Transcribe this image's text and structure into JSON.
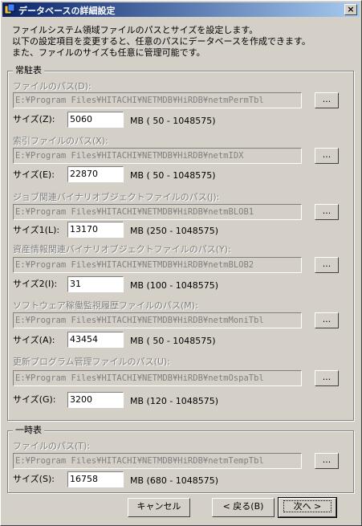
{
  "window": {
    "title": "データベースの詳細設定",
    "close_label": "×"
  },
  "intro": [
    "ファイルシステム領域ファイルのパスとサイズを設定します。",
    "以下の設定項目を変更すると、任意のパスにデータベースを作成できます。",
    "また、ファイルのサイズも任意に管理可能です。"
  ],
  "resident": {
    "legend": "常駐表",
    "items": [
      {
        "path_label": "ファイルのパス(D):",
        "path": "E:¥Program Files¥HITACHI¥NETMDB¥HiRDB¥netmPermTbl",
        "size_label": "サイズ(Z):",
        "size": "5060",
        "range": "MB ( 50 - 1048575)"
      },
      {
        "path_label": "索引ファイルのパス(X):",
        "path": "E:¥Program Files¥HITACHI¥NETMDB¥HiRDB¥netmIDX",
        "size_label": "サイズ(E):",
        "size": "22870",
        "range": "MB ( 50 - 1048575)"
      },
      {
        "path_label": "ジョブ関連バイナリオブジェクトファイルのパス(J):",
        "path": "E:¥Program Files¥HITACHI¥NETMDB¥HiRDB¥netmBLOB1",
        "size_label": "サイズ1(L):",
        "size": "13170",
        "range": "MB (250 - 1048575)"
      },
      {
        "path_label": "資産情報関連バイナリオブジェクトファイルのパス(Y):",
        "path": "E:¥Program Files¥HITACHI¥NETMDB¥HiRDB¥netmBLOB2",
        "size_label": "サイズ2(I):",
        "size": "31",
        "range": "MB (100 - 1048575)"
      },
      {
        "path_label": "ソフトウェア稼働監視履歴ファイルのパス(M):",
        "path": "E:¥Program Files¥HITACHI¥NETMDB¥HiRDB¥netmMoniTbl",
        "size_label": "サイズ(A):",
        "size": "43454",
        "range": "MB ( 50 - 1048575)"
      },
      {
        "path_label": "更新プログラム管理ファイルのパス(U):",
        "path": "E:¥Program Files¥HITACHI¥NETMDB¥HiRDB¥netmOspaTbl",
        "size_label": "サイズ(G):",
        "size": "3200",
        "range": "MB (120 - 1048575)"
      }
    ]
  },
  "temporary": {
    "legend": "一時表",
    "items": [
      {
        "path_label": "ファイルのパス(T):",
        "path": "E:¥Program Files¥HITACHI¥NETMDB¥HiRDB¥netmTempTbl",
        "size_label": "サイズ(S):",
        "size": "16758",
        "range": "MB (680 - 1048575)"
      }
    ]
  },
  "browse_label": "...",
  "buttons": {
    "cancel": "キャンセル",
    "back": "< 戻る(B)",
    "next": "次へ >"
  }
}
